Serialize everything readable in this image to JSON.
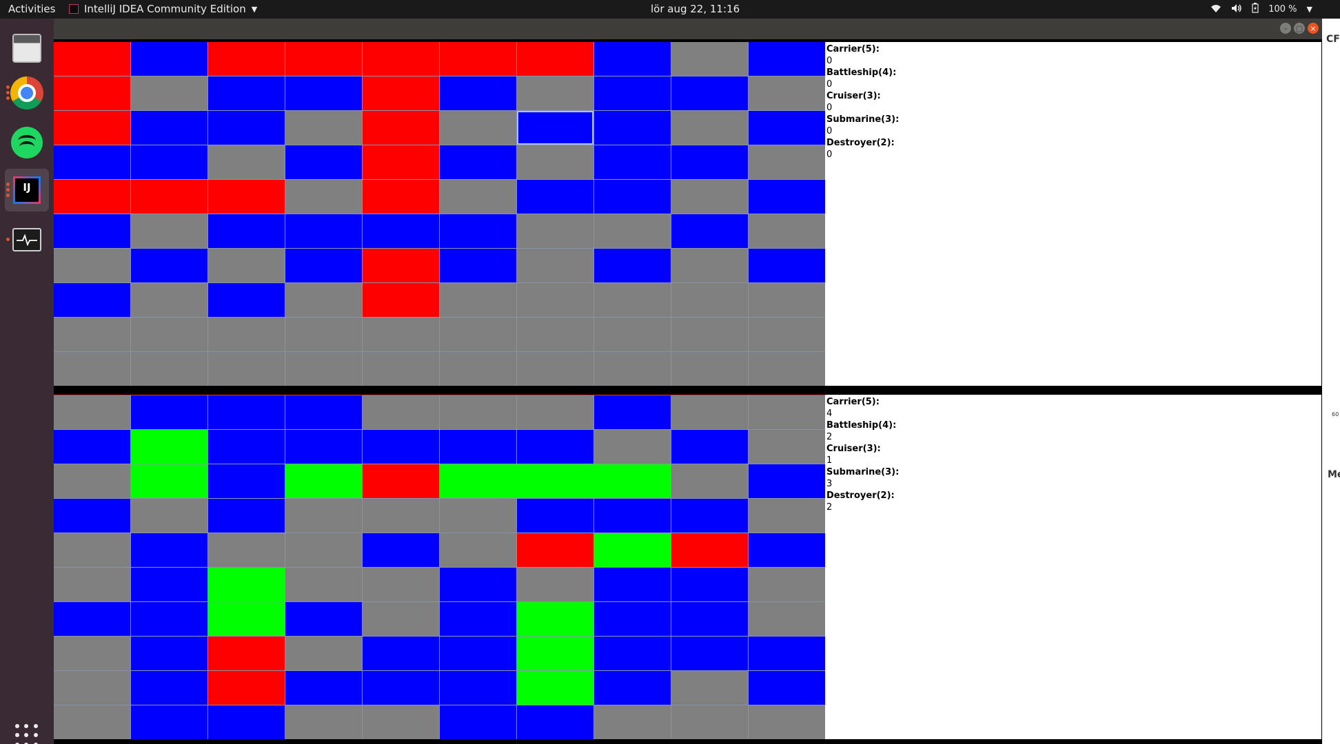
{
  "topbar": {
    "activities": "Activities",
    "app_name": "IntelliJ IDEA Community Edition",
    "clock": "lör aug 22, 11:16",
    "battery": "100 %"
  },
  "dock": {
    "items": [
      {
        "name": "files",
        "icon": "files-icon"
      },
      {
        "name": "chrome",
        "icon": "chrome-icon"
      },
      {
        "name": "spotify",
        "icon": "spotify-icon"
      },
      {
        "name": "intellij",
        "icon": "intellij-icon",
        "label": "IJ"
      },
      {
        "name": "system-monitor",
        "icon": "system-monitor-icon"
      }
    ]
  },
  "colors": {
    "blue": "#0000ff",
    "red": "#ff0000",
    "gray": "#808080",
    "green": "#00ff00"
  },
  "top_board": {
    "rows": [
      [
        "R",
        "B",
        "R",
        "R",
        "R",
        "R",
        "R",
        "B",
        "G",
        "B"
      ],
      [
        "R",
        "G",
        "B",
        "B",
        "R",
        "B",
        "G",
        "B",
        "B",
        "G"
      ],
      [
        "R",
        "B",
        "B",
        "G",
        "R",
        "G",
        "B",
        "B",
        "G",
        "B"
      ],
      [
        "B",
        "B",
        "G",
        "B",
        "R",
        "B",
        "G",
        "B",
        "B",
        "G"
      ],
      [
        "R",
        "R",
        "R",
        "G",
        "R",
        "G",
        "B",
        "B",
        "G",
        "B"
      ],
      [
        "B",
        "G",
        "B",
        "B",
        "B",
        "B",
        "G",
        "G",
        "B",
        "G"
      ],
      [
        "G",
        "B",
        "G",
        "B",
        "R",
        "B",
        "G",
        "B",
        "G",
        "B"
      ],
      [
        "B",
        "G",
        "B",
        "G",
        "R",
        "G",
        "G",
        "G",
        "G",
        "G"
      ],
      [
        "G",
        "G",
        "G",
        "G",
        "G",
        "G",
        "G",
        "G",
        "G",
        "G"
      ],
      [
        "G",
        "G",
        "G",
        "G",
        "G",
        "G",
        "G",
        "G",
        "G",
        "G"
      ]
    ],
    "legend": "R=red hit, B=blue miss, G=gray unknown, L=green ship"
  },
  "bottom_board": {
    "rows": [
      [
        "G",
        "B",
        "B",
        "B",
        "G",
        "G",
        "G",
        "B",
        "G",
        "G"
      ],
      [
        "B",
        "L",
        "B",
        "B",
        "B",
        "B",
        "B",
        "G",
        "B",
        "G"
      ],
      [
        "G",
        "L",
        "B",
        "L",
        "R",
        "L",
        "L",
        "L",
        "G",
        "B"
      ],
      [
        "B",
        "G",
        "B",
        "G",
        "G",
        "G",
        "B",
        "B",
        "B",
        "G"
      ],
      [
        "G",
        "B",
        "G",
        "G",
        "B",
        "G",
        "R",
        "L",
        "R",
        "B"
      ],
      [
        "G",
        "B",
        "L",
        "G",
        "G",
        "B",
        "G",
        "B",
        "B",
        "G"
      ],
      [
        "B",
        "B",
        "L",
        "B",
        "G",
        "B",
        "L",
        "B",
        "B",
        "G"
      ],
      [
        "G",
        "B",
        "R",
        "G",
        "B",
        "B",
        "L",
        "B",
        "B",
        "B"
      ],
      [
        "G",
        "B",
        "R",
        "B",
        "B",
        "B",
        "L",
        "B",
        "G",
        "B"
      ],
      [
        "G",
        "B",
        "B",
        "G",
        "G",
        "B",
        "B",
        "G",
        "G",
        "G"
      ]
    ]
  },
  "top_info": {
    "ships": [
      {
        "label": "Carrier(5):",
        "value": "0"
      },
      {
        "label": "Battleship(4):",
        "value": "0"
      },
      {
        "label": "Cruiser(3):",
        "value": "0"
      },
      {
        "label": "Submarine(3):",
        "value": "0"
      },
      {
        "label": "Destroyer(2):",
        "value": "0"
      }
    ]
  },
  "bottom_info": {
    "ships": [
      {
        "label": "Carrier(5):",
        "value": "4"
      },
      {
        "label": "Battleship(4):",
        "value": "2"
      },
      {
        "label": "Cruiser(3):",
        "value": "1"
      },
      {
        "label": "Submarine(3):",
        "value": "3"
      },
      {
        "label": "Destroyer(2):",
        "value": "2"
      }
    ]
  },
  "side_strip": {
    "text1": "CF",
    "text2": "60",
    "text3": "Me"
  }
}
